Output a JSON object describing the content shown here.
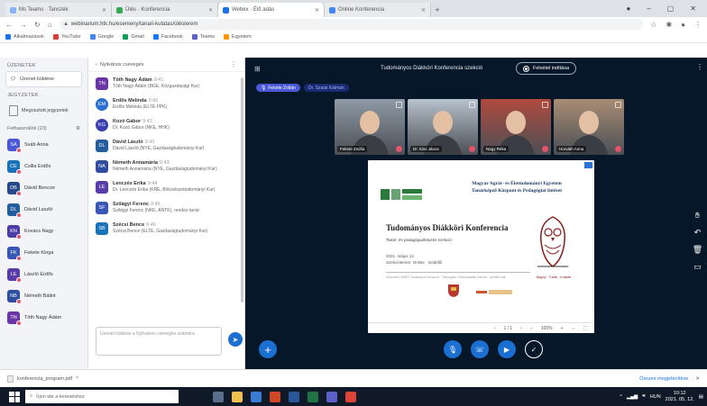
{
  "browser": {
    "tabs": [
      {
        "label": "Ms Teams · Tanszék",
        "active": false
      },
      {
        "label": "Ülés · Konferencia",
        "active": false
      },
      {
        "label": "Webex · Élő adás",
        "active": true
      },
      {
        "label": "Online Konferencia",
        "active": false
      }
    ],
    "url": "webinarium.htk.hu/esemeny/tanari-kutatas/ülésterem",
    "bookmarks": [
      "Alkalmazások",
      "YouTube",
      "Google",
      "Gmail",
      "Facebook",
      "Teams",
      "Egyetem"
    ],
    "colors": [
      "#1a73e8",
      "#e53935",
      "#4285f4",
      "#0f9d58",
      "#1877f2",
      "#5b5fc7",
      "#ff9800"
    ]
  },
  "rail": {
    "section1": "Üzenetek",
    "direct_item": "Üzenet küldése",
    "section2": "Jegyzetek",
    "note_item": "Megosztott jegyzetek",
    "users_head": "Felhasználók (23)",
    "users_gear": "⚙",
    "users": [
      {
        "initials": "SA",
        "name": "Sváb Anna",
        "color": "#4b59d6"
      },
      {
        "initials": "CE",
        "name": "Csilla Erdős",
        "color": "#1a73b8"
      },
      {
        "initials": "DB",
        "name": "Dávid Bencze",
        "color": "#26488c"
      },
      {
        "initials": "DL",
        "name": "Dávid Laszló",
        "color": "#225e9e"
      },
      {
        "initials": "KN",
        "name": "Kovács Nagy",
        "color": "#4b3da8"
      },
      {
        "initials": "FK",
        "name": "Fekete Kinga",
        "color": "#3856b5"
      },
      {
        "initials": "LE",
        "name": "László Erdős",
        "color": "#5a3ca8"
      },
      {
        "initials": "NB",
        "name": "Németh Bálint",
        "color": "#2f4ea0"
      },
      {
        "initials": "TN",
        "name": "Tóth Nagy Ádám",
        "color": "#6a35a5"
      }
    ]
  },
  "chat": {
    "header": "Nyilvános csevegés",
    "messages": [
      {
        "initials": "TN",
        "name": "Tóth Nagy Ádám",
        "time": "9:41",
        "text": "Tóth Nagy Ádám (BGE, Közgazdasági Kar)",
        "color": "#6a35a5"
      },
      {
        "initials": "EM",
        "name": "Erdős Melinda",
        "time": "9:42",
        "text": "Erdős Melinda (ELTE PPK)",
        "color": "#2d6fd1"
      },
      {
        "initials": "KG",
        "name": "Kozó Gábor",
        "time": "9:42",
        "text": "Dr. Kozó Gábor (NKE, HHK)",
        "color": "#3a3fb0"
      },
      {
        "initials": "DL",
        "name": "Dávid László",
        "time": "9:43",
        "text": "Dávid László (NYE, Gazdaságtudományi Kar)",
        "color": "#225e9e"
      },
      {
        "initials": "NA",
        "name": "Németh Annamária",
        "time": "9:43",
        "text": "Németh Annamária (NYE, Gazdaságtudományi Kar)",
        "color": "#2f4ea0"
      },
      {
        "initials": "LE",
        "name": "Lenczés Erika",
        "time": "9:44",
        "text": "Dr. Lenczés Erika (KRE, Bölcsészettudományi Kar)",
        "color": "#5a3ca8"
      },
      {
        "initials": "SF",
        "name": "Szilágyi Ferenc",
        "time": "9:45",
        "text": "Szilágyi Ferenc (NKE, ÁNTK), rendes tanár",
        "color": "#3856b5"
      },
      {
        "initials": "SB",
        "name": "Szécsi Bence",
        "time": "9:46",
        "text": "Szécsi Bence (ELTE, Gazdaságtudományi Kar)",
        "color": "#1a73b8"
      }
    ],
    "input_placeholder": "Üzenet küldése a Nyilvános csevegés számára",
    "send_icon": "➤"
  },
  "stage": {
    "title": "Tudományos Diákköri Konferencia szekció",
    "record_label": "Felvétel indítása",
    "talking": [
      {
        "label": "Fekete Zoltán",
        "type": "me"
      },
      {
        "label": "Dr. Szalai Kálmán",
        "type": "other"
      }
    ],
    "videos": [
      {
        "name": "Fekete Zsófia",
        "bg": "#8f9aa6"
      },
      {
        "name": "Dr. Kiss János",
        "bg": "#b7c2cc"
      },
      {
        "name": "Nagy Réka",
        "bg": "#b04a3e"
      },
      {
        "name": "Horváth Anna",
        "bg": "#a98c74"
      }
    ],
    "slide": {
      "org": "Magyar Agrár- és Élettudományi Egyetem\nTanárképző Központ és Pedagógiai Intézet",
      "title": "Tudományos Diákköri Konferencia",
      "subtitle": "Tanár- és pedagógusképzés szekció",
      "details": "2021. május 12.\nSzekcióterem: Online · Gödöllő",
      "small": "Szervező: MATE Tanárképző Központ · Támogató: Felsőoktatási Intézet · gödöllői kar",
      "owl_caption": "Bagoly · Tudás · Kutatás",
      "zoom": "100%",
      "page": "1 / 1"
    }
  }
}
